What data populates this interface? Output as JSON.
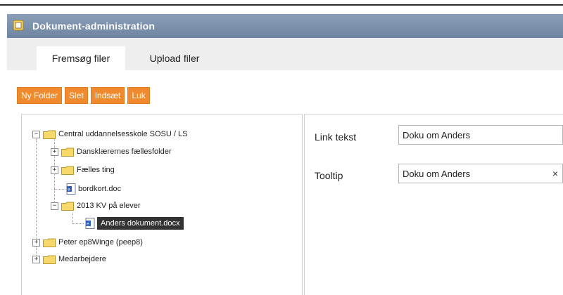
{
  "window": {
    "title": "Dokument-administration"
  },
  "tabs": [
    {
      "label": "Fremsøg filer",
      "active": true
    },
    {
      "label": "Upload filer",
      "active": false
    }
  ],
  "toolbar": {
    "new_folder": "Ny Folder",
    "delete": "Slet",
    "paste": "Indsæt",
    "close": "Luk"
  },
  "tree": {
    "root": "Central uddannelsesskole SOSU / LS",
    "children": [
      {
        "label": "Dansklærernes fællesfolder",
        "type": "folder",
        "toggle": "+"
      },
      {
        "label": "Fælles ting",
        "type": "folder",
        "toggle": "+"
      },
      {
        "label": "bordkort.doc",
        "type": "document"
      },
      {
        "label": "2013 KV på elever",
        "type": "folder",
        "toggle": "−"
      },
      {
        "label": "Anders dokument.docx",
        "type": "document",
        "selected": true
      }
    ],
    "siblings": [
      {
        "label": "Peter ep8Winge (peep8)",
        "type": "folder",
        "toggle": "+"
      },
      {
        "label": "Medarbejdere",
        "type": "folder",
        "toggle": "+"
      }
    ]
  },
  "detail": {
    "link_text_label": "Link tekst",
    "link_text_value": "Doku om Anders",
    "tooltip_label": "Tooltip",
    "tooltip_value": "Doku om Anders",
    "clear_glyph": "×"
  },
  "colors": {
    "accent": "#f08a2e",
    "titlebar": "#7d92ad",
    "selection": "#333333"
  }
}
